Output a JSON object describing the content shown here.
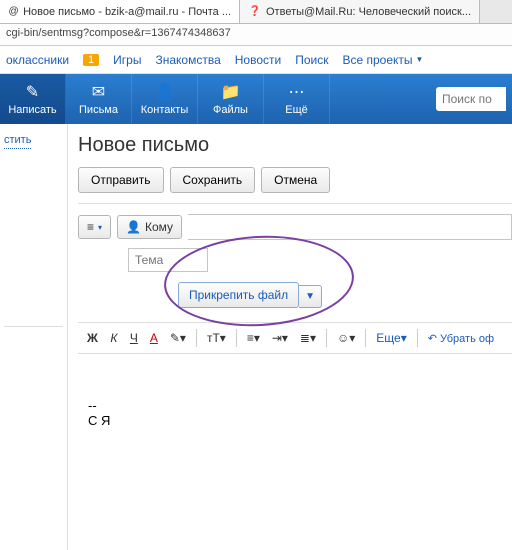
{
  "browser": {
    "tabs": [
      {
        "title": "Новое письмо - bzik-a@mail.ru - Почта ...",
        "active": true
      },
      {
        "title": "Ответы@Mail.Ru: Человеческий поиск...",
        "active": false
      }
    ],
    "address": "cgi-bin/sentmsg?compose&r=1367474348637"
  },
  "topnav": {
    "items": [
      "оклассники",
      "Игры",
      "Знакомства",
      "Новости",
      "Поиск",
      "Все проекты"
    ],
    "badge": "1"
  },
  "toolbar": {
    "items": [
      {
        "label": "Написать",
        "icon": "✎"
      },
      {
        "label": "Письма",
        "icon": "✉"
      },
      {
        "label": "Контакты",
        "icon": "👤"
      },
      {
        "label": "Файлы",
        "icon": "📁"
      },
      {
        "label": "Ещё",
        "icon": "⋯"
      }
    ],
    "search_placeholder": "Поиск по"
  },
  "sidebar": {
    "link": "стить"
  },
  "compose": {
    "title": "Новое письмо",
    "send": "Отправить",
    "save": "Сохранить",
    "cancel": "Отмена",
    "to_label": "Кому",
    "subject_placeholder": "Тема",
    "attach": "Прикрепить файл",
    "more": "Еще",
    "remove_format": "Убрать оф",
    "body_sig1": "--",
    "body_sig2": "С Я"
  },
  "format": {
    "bold": "Ж",
    "italic": "К",
    "underline": "Ч",
    "color": "А"
  }
}
